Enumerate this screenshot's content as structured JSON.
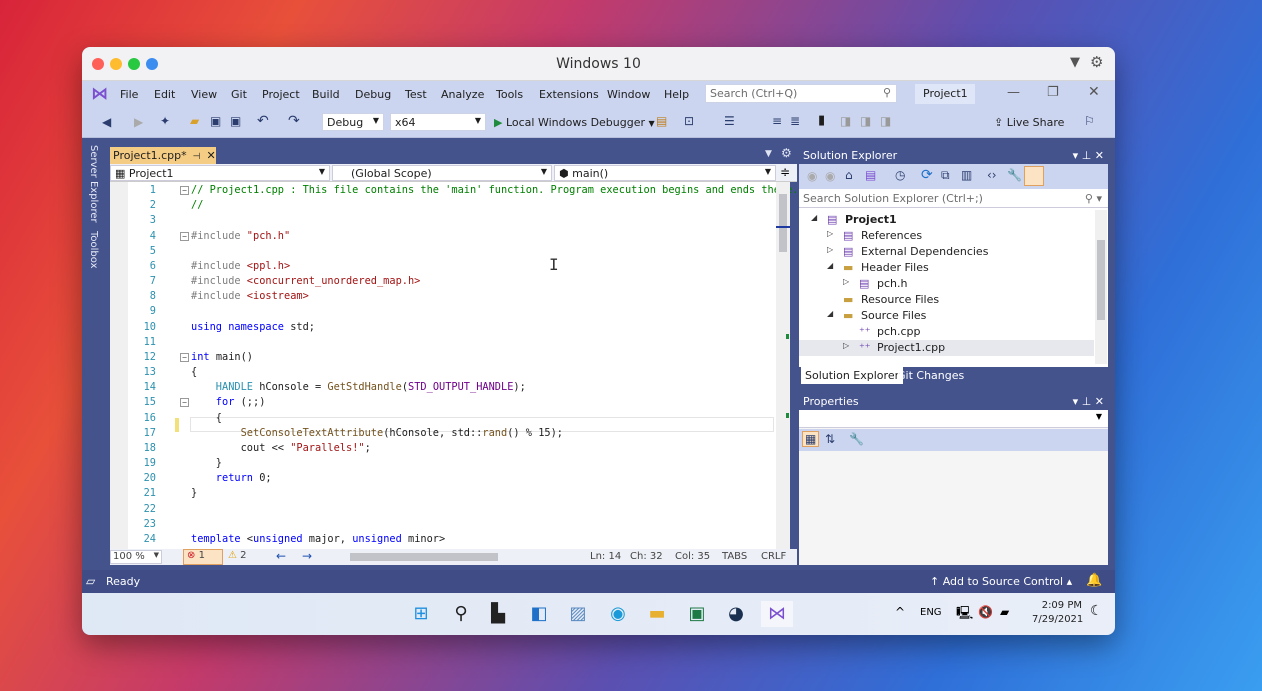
{
  "titlebar": {
    "title": "Windows 10",
    "colors": {
      "close": "#fe5f57",
      "minimize": "#febc2e",
      "zoom": "#28c840",
      "extra": "#3b8ef0"
    }
  },
  "menu": {
    "items": [
      "File",
      "Edit",
      "View",
      "Git",
      "Project",
      "Build",
      "Debug",
      "Test",
      "Analyze",
      "Tools",
      "Extensions",
      "Window",
      "Help"
    ],
    "search_placeholder": "Search (Ctrl+Q)",
    "project": "Project1"
  },
  "toolbar": {
    "config": "Debug",
    "platform": "x64",
    "run_label": "Local Windows Debugger",
    "live_share": "Live Share"
  },
  "side_tabs": [
    "Server Explorer",
    "Toolbox"
  ],
  "editor": {
    "tab": "Project1.cpp*",
    "nav_project": "Project1",
    "nav_scope": "(Global Scope)",
    "nav_member": "main()",
    "lines": [
      [
        [
          "// Project1.cpp : This file contains the 'main' function. Program execution begins and ends there.",
          "c"
        ]
      ],
      [
        [
          "//",
          "c"
        ]
      ],
      [],
      [
        [
          "#include ",
          "p"
        ],
        [
          "\"pch.h\"",
          "s"
        ]
      ],
      [],
      [
        [
          "#include ",
          "p"
        ],
        [
          "<ppl.h>",
          "s"
        ]
      ],
      [
        [
          "#include ",
          "p"
        ],
        [
          "<concurrent_unordered_map.h>",
          "s"
        ]
      ],
      [
        [
          "#include ",
          "p"
        ],
        [
          "<iostream>",
          "s"
        ]
      ],
      [],
      [
        [
          "using ",
          "k"
        ],
        [
          "namespace ",
          "k"
        ],
        [
          "std;",
          ""
        ]
      ],
      [],
      [
        [
          "int ",
          "k"
        ],
        [
          "main()",
          ""
        ]
      ],
      [
        [
          "{",
          ""
        ]
      ],
      [
        [
          "    HANDLE ",
          "t"
        ],
        [
          "hConsole = ",
          ""
        ],
        [
          "GetStdHandle",
          "f"
        ],
        [
          "(",
          ""
        ],
        [
          "STD_OUTPUT_HANDLE",
          "m"
        ],
        [
          ");",
          ""
        ]
      ],
      [
        [
          "    for ",
          "k"
        ],
        [
          "(;;)",
          ""
        ]
      ],
      [
        [
          "    {",
          ""
        ]
      ],
      [
        [
          "        SetConsoleTextAttribute",
          "f"
        ],
        [
          "(hConsole, std::",
          ""
        ],
        [
          "rand",
          "f"
        ],
        [
          "() % 15);",
          ""
        ]
      ],
      [
        [
          "        cout << ",
          ""
        ],
        [
          "\"Parallels!\"",
          "s"
        ],
        [
          ";",
          ""
        ]
      ],
      [
        [
          "    }",
          ""
        ]
      ],
      [
        [
          "    return ",
          "k"
        ],
        [
          "0;",
          ""
        ]
      ],
      [
        [
          "}",
          ""
        ]
      ],
      [],
      [],
      [
        [
          "template ",
          "k"
        ],
        [
          "<",
          ""
        ],
        [
          "unsigned ",
          "k"
        ],
        [
          "major, ",
          ""
        ],
        [
          "unsigned ",
          "k"
        ],
        [
          "minor>",
          ""
        ]
      ]
    ],
    "zoom": "100 %",
    "errors": "1",
    "warnings": "2",
    "ln": "Ln: 14",
    "ch": "Ch: 32",
    "col": "Col: 35",
    "tabs": "TABS",
    "eol": "CRLF"
  },
  "solution_explorer": {
    "title": "Solution Explorer",
    "search_placeholder": "Search Solution Explorer (Ctrl+;)",
    "tree": [
      {
        "label": "Project1",
        "level": 0,
        "bold": true,
        "expander": "◢",
        "icon": "project-icon"
      },
      {
        "label": "References",
        "level": 1,
        "expander": "▷",
        "icon": "references-icon"
      },
      {
        "label": "External Dependencies",
        "level": 1,
        "expander": "▷",
        "icon": "dependencies-icon"
      },
      {
        "label": "Header Files",
        "level": 1,
        "expander": "◢",
        "icon": "folder-icon"
      },
      {
        "label": "pch.h",
        "level": 2,
        "expander": "▷",
        "icon": "header-file-icon"
      },
      {
        "label": "Resource Files",
        "level": 1,
        "expander": "",
        "icon": "folder-icon"
      },
      {
        "label": "Source Files",
        "level": 1,
        "expander": "◢",
        "icon": "folder-icon"
      },
      {
        "label": "pch.cpp",
        "level": 2,
        "expander": "",
        "icon": "cpp-file-icon"
      },
      {
        "label": "Project1.cpp",
        "level": 2,
        "expander": "▷",
        "icon": "cpp-file-icon",
        "selected": true
      }
    ],
    "tabs": [
      "Solution Explorer",
      "Git Changes"
    ]
  },
  "properties": {
    "title": "Properties"
  },
  "status": {
    "ready": "Ready",
    "source_control": "Add to Source Control"
  },
  "taskbar": {
    "lang": "ENG",
    "time": "2:09 PM",
    "date": "7/29/2021",
    "apps": [
      "start-icon",
      "search-icon",
      "task-view-icon",
      "widgets-icon",
      "photos-icon",
      "edge-icon",
      "file-explorer-icon",
      "excel-icon",
      "steam-icon",
      "visual-studio-icon"
    ]
  }
}
